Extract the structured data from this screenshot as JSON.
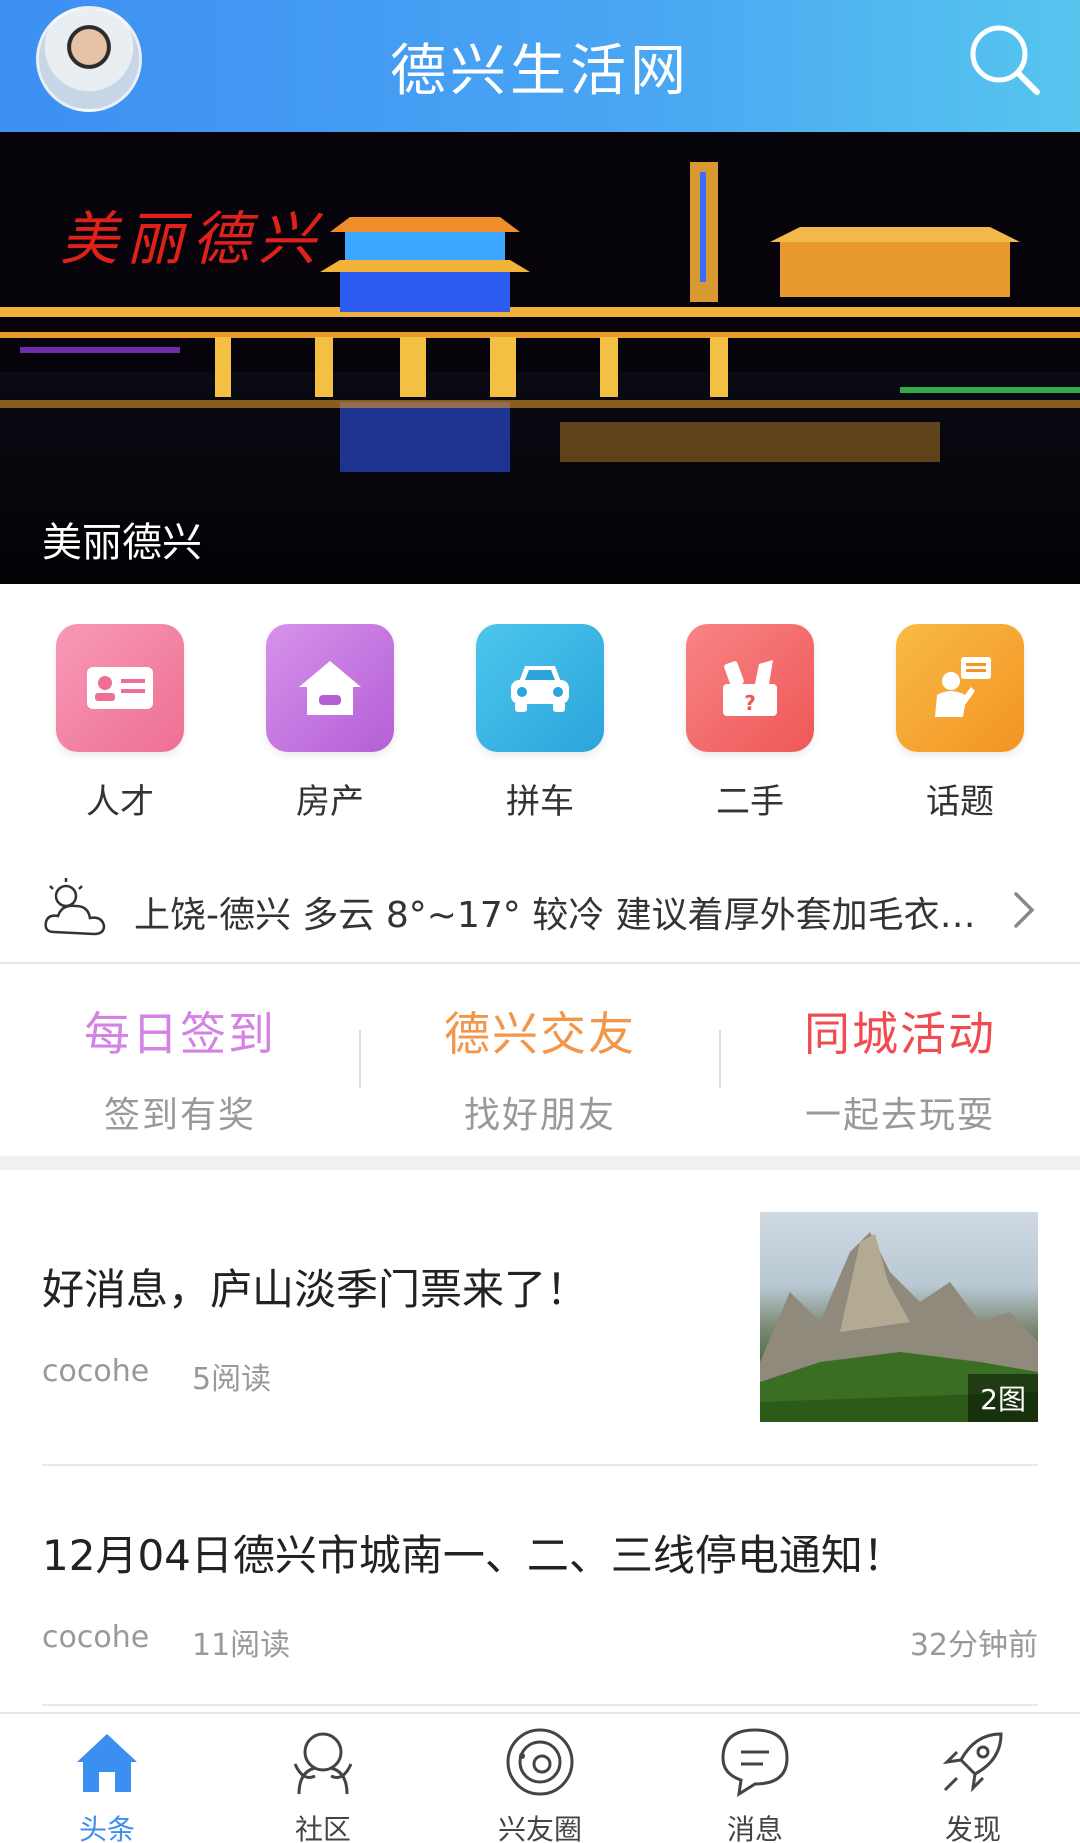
{
  "header": {
    "title": "德兴生活网",
    "avatar": "user-avatar",
    "search_icon": "search-icon"
  },
  "banner": {
    "script_text": "美丽德兴",
    "caption": "美丽德兴"
  },
  "categories": [
    {
      "label": "人才",
      "icon": "id-card-icon",
      "color": "#f27fa0"
    },
    {
      "label": "房产",
      "icon": "house-handshake-icon",
      "color": "#c477e0"
    },
    {
      "label": "拼车",
      "icon": "car-icon",
      "color": "#3fb5e4"
    },
    {
      "label": "二手",
      "icon": "secondhand-box-icon",
      "color": "#f46a6a"
    },
    {
      "label": "话题",
      "icon": "speech-person-icon",
      "color": "#f6a833"
    }
  ],
  "weather": {
    "text": "上饶-德兴 多云 8°~17° 较冷 建议着厚外套加毛衣…",
    "icon": "partly-cloudy-icon"
  },
  "quick_links": [
    {
      "title": "每日签到",
      "subtitle": "签到有奖",
      "color": "#d482e4"
    },
    {
      "title": "德兴交友",
      "subtitle": "找好朋友",
      "color": "#f2964a"
    },
    {
      "title": "同城活动",
      "subtitle": "一起去玩耍",
      "color": "#ef4b50"
    }
  ],
  "news": [
    {
      "title": "好消息，庐山淡季门票来了！",
      "author": "cocohe",
      "reads": "5阅读",
      "image_badge": "2图"
    },
    {
      "title": "12月04日德兴市城南一、二、三线停电通知！",
      "author": "cocohe",
      "reads": "11阅读",
      "time": "32分钟前"
    }
  ],
  "tabs": [
    {
      "label": "头条",
      "icon": "home-icon",
      "active": true
    },
    {
      "label": "社区",
      "icon": "community-icon",
      "active": false
    },
    {
      "label": "兴友圈",
      "icon": "circle-icon",
      "active": false
    },
    {
      "label": "消息",
      "icon": "message-icon",
      "active": false
    },
    {
      "label": "发现",
      "icon": "rocket-icon",
      "active": false
    }
  ],
  "colors": {
    "header": "#3d8ff2",
    "active_tab": "#3b8ff0"
  }
}
